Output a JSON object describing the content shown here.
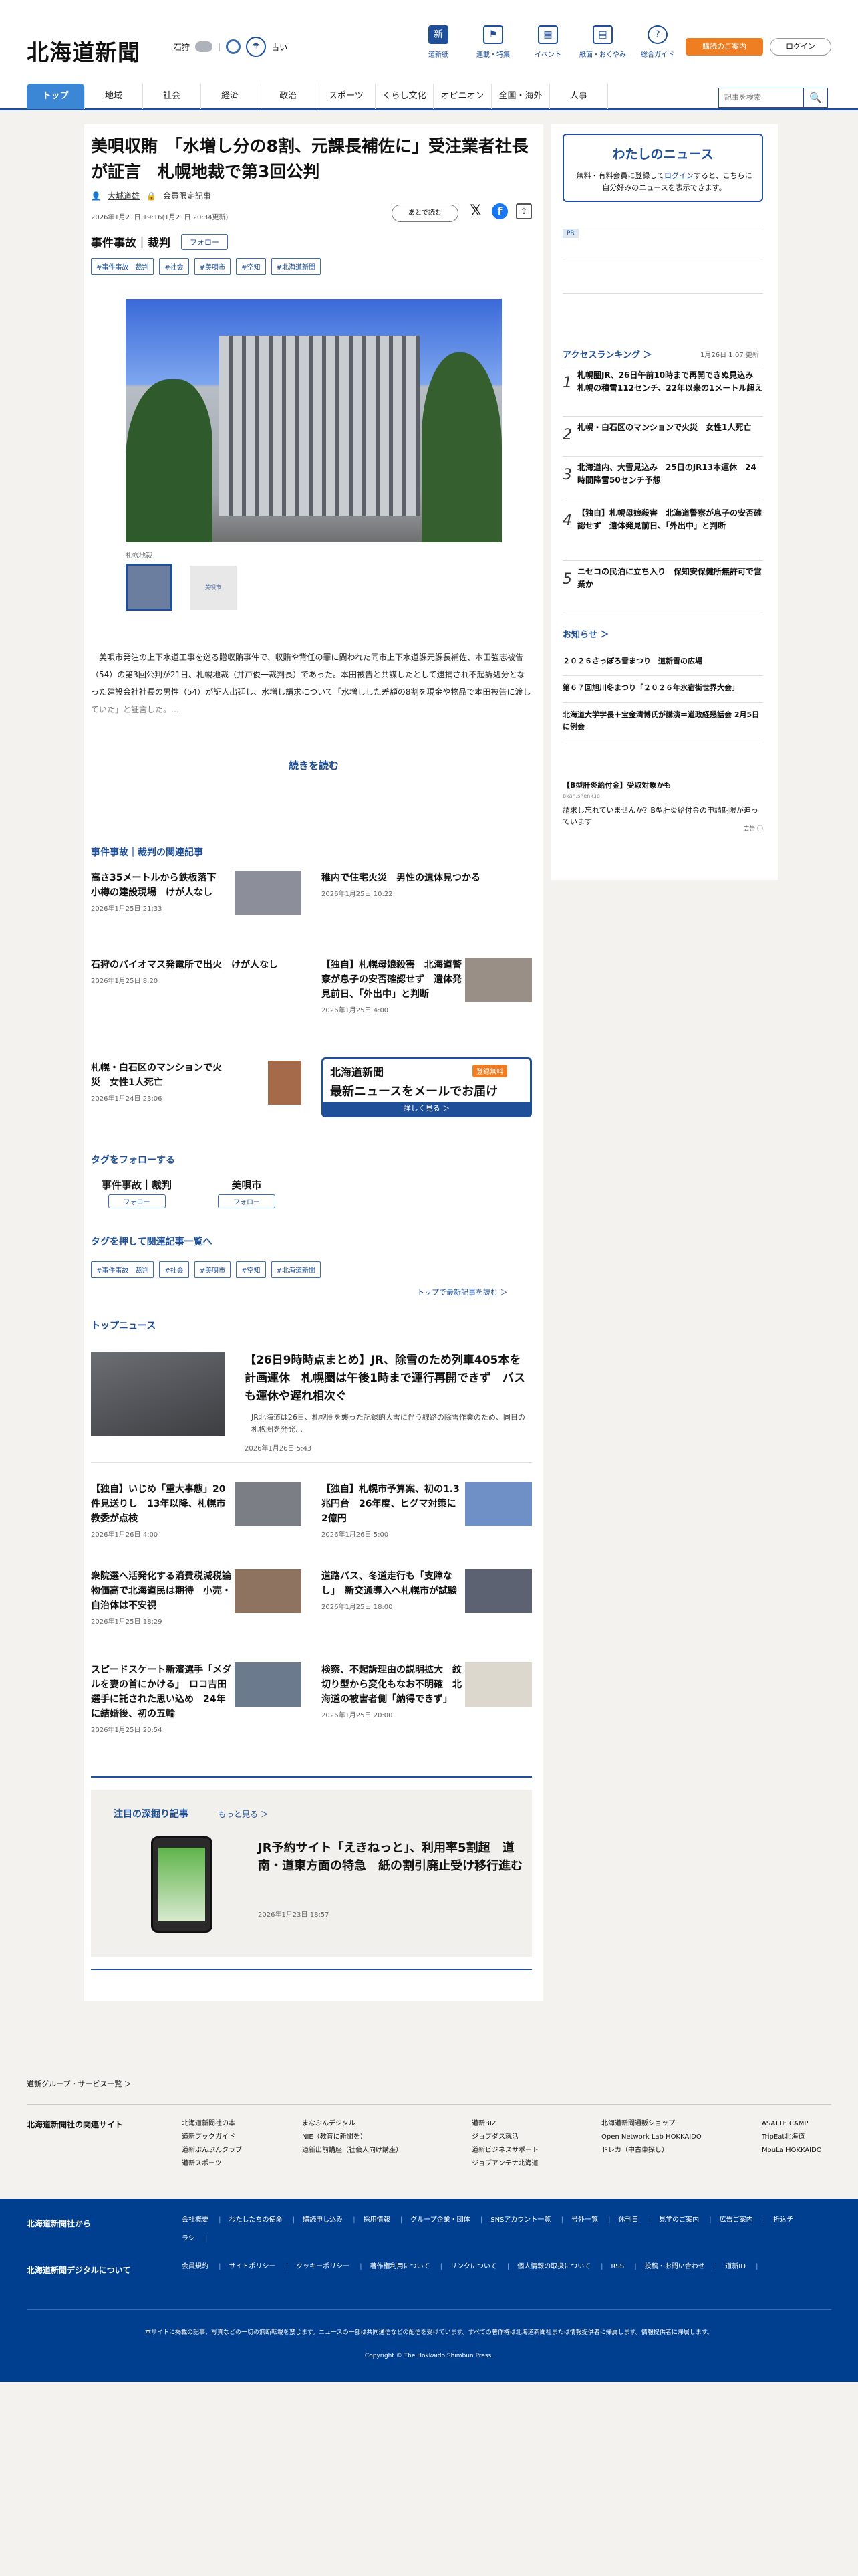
{
  "header": {
    "logo": "北海道新聞",
    "city": "石狩",
    "rain": "☂",
    "rain_label": "占い",
    "nav": [
      {
        "icon": "新",
        "label": "道新紙"
      },
      {
        "icon": "⚑",
        "label": "連載・特集"
      },
      {
        "icon": "▦",
        "label": "イベント"
      },
      {
        "icon": "▤",
        "label": "紙面・おくやみ"
      },
      {
        "icon": "?",
        "label": "総合ガイド"
      }
    ],
    "register": "購読のご案内",
    "login": "ログイン"
  },
  "gnav": {
    "tabs": [
      "トップ",
      "地域",
      "社会",
      "経済",
      "政治",
      "スポーツ",
      "くらし文化",
      "オピニオン",
      "全国・海外",
      "人事"
    ],
    "search_placeholder": "記事を検索",
    "search_icon": "🔍"
  },
  "article": {
    "title": "美唄収賄　「水増し分の8割、元課長補佐に」受注業者社長が証言　札幌地裁で第3回公判",
    "author": "大城道雄",
    "member": "会員限定記事",
    "date": "2026年1月21日 19:16(1月21日 20:34更新)",
    "save": "あとで読む",
    "social": {
      "x": "𝕏",
      "fb": "f",
      "share": "⇧"
    },
    "category": "事件事故｜裁判",
    "follow": "フォロー",
    "tags": [
      "#事件事故｜裁判",
      "#社会",
      "#美唄市",
      "#空知",
      "#北海道新聞"
    ],
    "caption": "札幌地裁",
    "thumb2": "美唄市",
    "body": "美唄市発注の上下水道工事を巡る贈収賄事件で、収賄や背任の罪に問われた同市上下水道課元課長補佐、本田強志被告（54）の第3回公判が21日、札幌地裁（井戸俊一裁判長）であった。本田被告と共謀したとして逮捕され不起訴処分となった建設会社社長の男性（54）が証人出廷し、水増し請求について「水増しした差額の8割を現金や物品で本田被告に渡していた」と証言した。…",
    "more": "続きを読む"
  },
  "related": {
    "heading": "事件事故｜裁判の関連記事",
    "items": [
      {
        "title": "高さ35メートルから鉄板落下　小樽の建設現場　けが人なし",
        "date": "2026年1月25日 21:33"
      },
      {
        "title": "稚内で住宅火災　男性の遺体見つかる",
        "date": "2026年1月25日 10:22"
      },
      {
        "title": "石狩のバイオマス発電所で出火　けが人なし",
        "date": "2026年1月25日 8:20"
      },
      {
        "title": "【独自】札幌母娘殺害　北海道警察が息子の安否確認せず　遺体発見前日、「外出中」と判断",
        "date": "2026年1月25日 4:00"
      },
      {
        "title": "札幌・白石区のマンションで火災　女性1人死亡",
        "date": "2026年1月24日 23:06"
      }
    ]
  },
  "banner": {
    "logo": "北海道新聞",
    "badge": "登録無料",
    "text": "最新ニュースをメールでお届け",
    "more": "詳しく見る ＞"
  },
  "follow_tags": {
    "heading": "タグをフォローする",
    "items": [
      "事件事故｜裁判",
      "美唄市"
    ]
  },
  "tag_list": {
    "heading": "タグを押して関連記事一覧へ",
    "tags": [
      "#事件事故｜裁判",
      "#社会",
      "#美唄市",
      "#空知",
      "#北海道新聞"
    ],
    "to_top": "トップで最新記事を読む ＞"
  },
  "top_news": {
    "heading": "トップニュース",
    "lead": {
      "title": "【26日9時時点まとめ】JR、除雪のため列車405本を計画運休　札幌圏は午後1時まで運行再開できず　バスも運休や遅れ相次ぐ",
      "excerpt": "JR北海道は26日、札幌圏を襲った記録的大雪に伴う線路の除雪作業のため、同日の札幌圏を発発…",
      "date": "2026年1月26日 5:43"
    },
    "items": [
      {
        "title": "【独自】いじめ「重大事態」20件見送りし　13年以降、札幌市教委が点検",
        "date": "2026年1月26日 4:00"
      },
      {
        "title": "【独自】札幌市予算案、初の1.3兆円台　26年度、ヒグマ対策に2億円",
        "date": "2026年1月26日 5:00"
      },
      {
        "title": "衆院選へ活発化する消費税減税論　物価高で北海道民は期待　小売・自治体は不安視",
        "date": "2026年1月25日 18:29"
      },
      {
        "title": "道路バス、冬道走行も「支障なし」　新交通導入へ札幌市が試験",
        "date": "2026年1月25日 18:00"
      },
      {
        "title": "スピードスケート新濱選手「メダルを妻の首にかける」　ロコ吉田選手に託された思い込め　24年に結婚後、初の五輪",
        "date": "2026年1月25日 20:54"
      },
      {
        "title": "検察、不起訴理由の説明拡大　紋切り型から変化もなお不明確　北海道の被害者側「納得できず」",
        "date": "2026年1月25日 20:00"
      }
    ]
  },
  "deep": {
    "heading": "注目の深掘り記事",
    "more": "もっと見る ＞",
    "title": "JR予約サイト「えきねっと」、利用率5割超　道南・道東方面の特急　紙の割引廃止受け移行進む",
    "date": "2026年1月23日 18:57"
  },
  "sidebar": {
    "my_heading": "わたしのニュース",
    "my_text_1": "無料・有料会員に登録して",
    "my_login": "ログイン",
    "my_text_2": "すると、こちらに自分好みのニュースを表示できます。",
    "pr": "PR",
    "ranking_heading": "アクセスランキング ＞",
    "ranking_date": "1月26日 1:07 更新",
    "ranking": [
      {
        "n": "1",
        "t": "札幌圏JR、26日午前10時まで再開できぬ見込み　札幌の積雪112センチ、22年以来の1メートル超え"
      },
      {
        "n": "2",
        "t": "札幌・白石区のマンションで火災　女性1人死亡"
      },
      {
        "n": "3",
        "t": "北海道内、大雪見込み　25日のJR13本運休　24時間降雪50センチ予想"
      },
      {
        "n": "4",
        "t": "【独自】札幌母娘殺害　北海道警察が息子の安否確認せず　遺体発見前日、「外出中」と判断"
      },
      {
        "n": "5",
        "t": "ニセコの民泊に立ち入り　保知安保健所無許可で営業か"
      }
    ],
    "notice_heading": "お知らせ ＞",
    "notices": [
      "２０２６さっぽろ雪まつり　道新雪の広場",
      "第６７回旭川冬まつり「２０２６年氷宿街世界大会」",
      "北海道大学学長＋宝金清博氏が講演＝道政経懇話会 2月5日に例会"
    ],
    "sp_title": "【B型肝炎給付金】受取対象かも",
    "sp_url": "bkan.shenk.jp",
    "sp_body": "請求し忘れていませんか？B型肝炎給付金の申請期限が迫っています",
    "sp_ad": "広告 ⓘ"
  },
  "footer": {
    "group": "道新グループ・サービス一覧 ＞",
    "related_label": "北海道新聞社の関連サイト",
    "cols": [
      [
        "北海道新聞社の本",
        "道新ブックガイド",
        "道新ぶんぶんクラブ",
        "道新スポーツ"
      ],
      [
        "まなぶんデジタル",
        "NIE（教育に新聞を）",
        "道新出前講座（社会人向け講座）"
      ],
      [
        "道新BIZ",
        "ジョブダス就活",
        "道新ビジネスサポート",
        "ジョブアンテナ北海道"
      ],
      [
        "北海道新聞通販ショップ",
        "Open Network Lab HOKKAIDO",
        "ドレカ（中古車探し）"
      ],
      [
        "ASATTE CAMP",
        "TripEat北海道",
        "MouLa HOKKAIDO"
      ]
    ],
    "from_label": "北海道新聞社から",
    "from_links": [
      "会社概要",
      "わたしたちの使命",
      "購読申し込み",
      "採用情報",
      "グループ企業・団体",
      "SNSアカウント一覧",
      "号外一覧",
      "休刊日",
      "見学のご案内",
      "広告ご案内",
      "折込チラシ"
    ],
    "digital_label": "北海道新聞デジタルについて",
    "digital_links": [
      "会員規約",
      "サイトポリシー",
      "クッキーポリシー",
      "著作権利用について",
      "リンクについて",
      "個人情報の取扱について",
      "RSS",
      "投稿・お問い合わせ",
      "道新ID"
    ],
    "note": "本サイトに掲載の記事、写真などの一切の無断転載を禁じます。ニュースの一部は共同通信などの配信を受けています。すべての著作権は北海道新聞社または情報提供者に帰属します。情報提供者に帰属します。",
    "copyright": "Copyright © The Hokkaido Shimbun Press."
  }
}
